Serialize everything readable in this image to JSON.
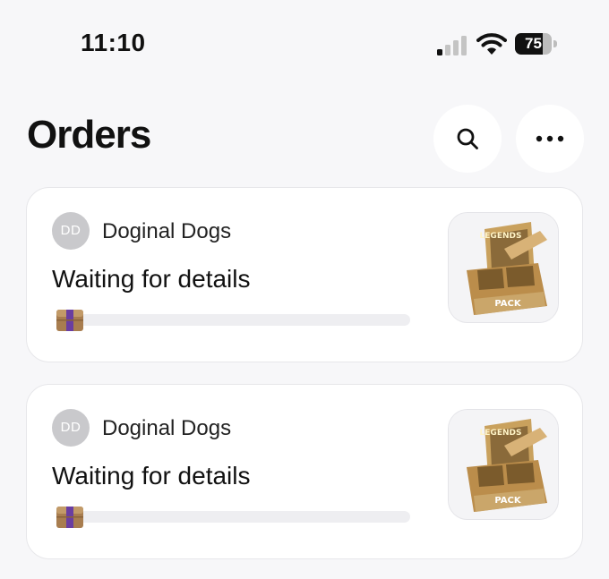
{
  "status_bar": {
    "time": "11:10",
    "battery_level": "75",
    "signal_bars_active": 1,
    "signal_bars_total": 4
  },
  "header": {
    "title": "Orders",
    "search_icon": "search-icon",
    "more_icon": "more-horizontal-icon"
  },
  "orders": [
    {
      "seller_initials": "DD",
      "seller_name": "Doginal Dogs",
      "status": "Waiting for details",
      "progress": 0.05,
      "thumbnail": "legends-pack-box-image"
    },
    {
      "seller_initials": "DD",
      "seller_name": "Doginal Dogs",
      "status": "Waiting for details",
      "progress": 0.05,
      "thumbnail": "legends-pack-box-image"
    }
  ],
  "colors": {
    "background": "#f7f7f9",
    "card": "#ffffff",
    "progress_track": "#eeeef1",
    "package_brown": "#a87d4f",
    "package_tape": "#6a3ea1"
  }
}
